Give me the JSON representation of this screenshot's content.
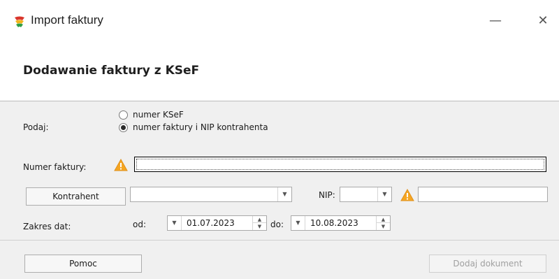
{
  "window": {
    "title": "Import faktury",
    "app_icon": "comarch-optima-icon",
    "minimize_glyph": "—",
    "close_glyph": "✕"
  },
  "header": {
    "title": "Dodawanie faktury z KSeF"
  },
  "form": {
    "podaj_label": "Podaj:",
    "radio_options": [
      {
        "label": "numer KSeF",
        "checked": false
      },
      {
        "label": "numer faktury i NIP kontrahenta",
        "checked": true
      }
    ],
    "numer_faktury_label": "Numer faktury:",
    "numer_faktury_value": "",
    "kontrahent_button": "Kontrahent",
    "kontrahent_value": "",
    "nip_label": "NIP:",
    "nip_prefix_value": "",
    "nip_value": "",
    "zakres_dat_label": "Zakres dat:",
    "od_label": "od:",
    "od_value": "01.07.2023",
    "do_label": "do:",
    "do_value": "10.08.2023"
  },
  "footer": {
    "help_button": "Pomoc",
    "add_button": "Dodaj dokument",
    "add_button_enabled": false
  },
  "colors": {
    "panel_bg": "#f0f0f0",
    "warning": "#f5a623",
    "disabled_text": "#a0a0a0"
  }
}
